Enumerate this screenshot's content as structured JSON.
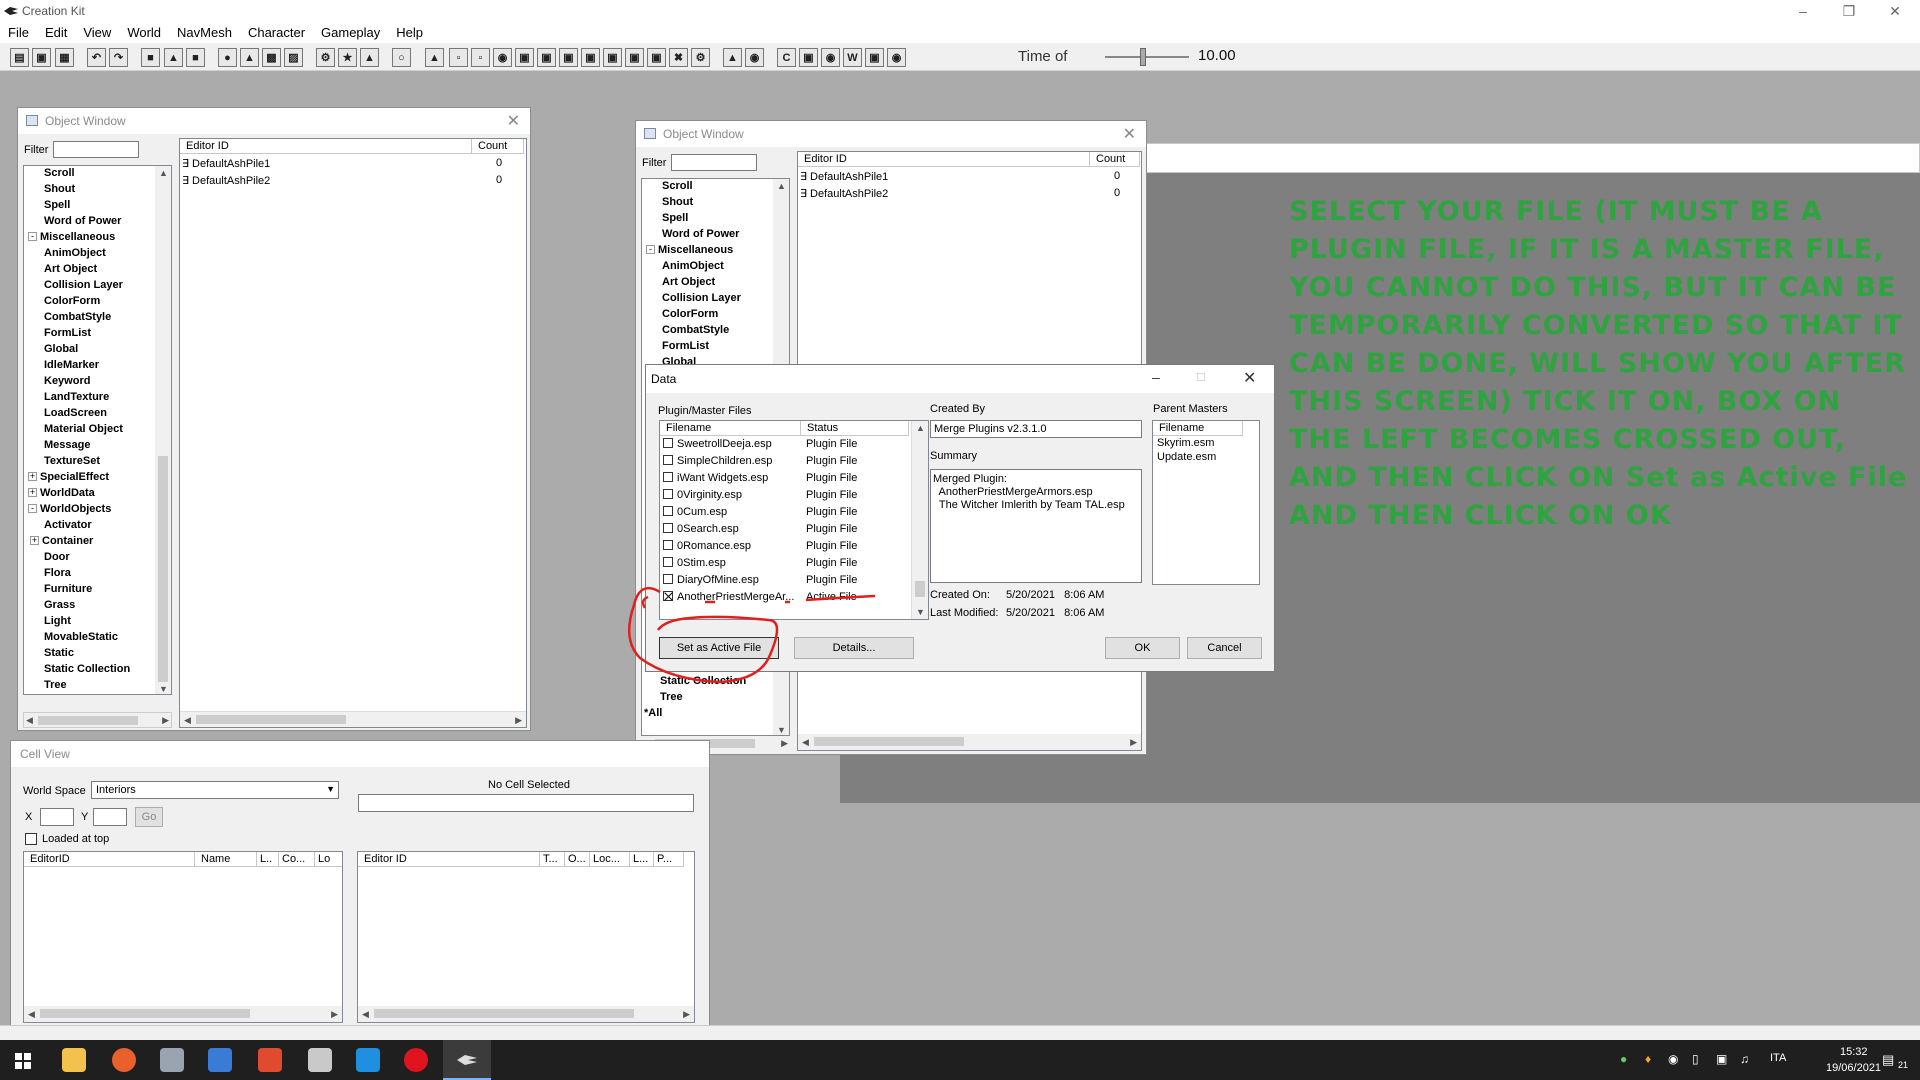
{
  "app": {
    "title": "Creation Kit"
  },
  "menu": [
    "File",
    "Edit",
    "View",
    "World",
    "NavMesh",
    "Character",
    "Gameplay",
    "Help"
  ],
  "toolbar": {
    "time_label": "Time of",
    "time_value": "10.00",
    "time_fraction": 0.45
  },
  "object_window": {
    "title": "Object Window",
    "filter_label": "Filter",
    "col_editor_id": "Editor ID",
    "col_count": "Count",
    "rows": [
      {
        "id": "DefaultAshPile1",
        "count": "0"
      },
      {
        "id": "DefaultAshPile2",
        "count": "0"
      }
    ],
    "tree": [
      {
        "label": "Scroll",
        "level": 1
      },
      {
        "label": "Shout",
        "level": 1
      },
      {
        "label": "Spell",
        "level": 1
      },
      {
        "label": "Word of Power",
        "level": 1
      },
      {
        "label": "Miscellaneous",
        "level": 0,
        "exp": "-"
      },
      {
        "label": "AnimObject",
        "level": 1
      },
      {
        "label": "Art Object",
        "level": 1
      },
      {
        "label": "Collision Layer",
        "level": 1
      },
      {
        "label": "ColorForm",
        "level": 1
      },
      {
        "label": "CombatStyle",
        "level": 1
      },
      {
        "label": "FormList",
        "level": 1
      },
      {
        "label": "Global",
        "level": 1
      },
      {
        "label": "IdleMarker",
        "level": 1
      },
      {
        "label": "Keyword",
        "level": 1
      },
      {
        "label": "LandTexture",
        "level": 1
      },
      {
        "label": "LoadScreen",
        "level": 1
      },
      {
        "label": "Material Object",
        "level": 1
      },
      {
        "label": "Message",
        "level": 1
      },
      {
        "label": "TextureSet",
        "level": 1
      },
      {
        "label": "SpecialEffect",
        "level": 0,
        "exp": "+"
      },
      {
        "label": "WorldData",
        "level": 0,
        "exp": "+"
      },
      {
        "label": "WorldObjects",
        "level": 0,
        "exp": "-"
      },
      {
        "label": "Activator",
        "level": 1
      },
      {
        "label": "Container",
        "level": 1,
        "exp": "+"
      },
      {
        "label": "Door",
        "level": 1
      },
      {
        "label": "Flora",
        "level": 1
      },
      {
        "label": "Furniture",
        "level": 1
      },
      {
        "label": "Grass",
        "level": 1
      },
      {
        "label": "Light",
        "level": 1
      },
      {
        "label": "MovableStatic",
        "level": 1
      },
      {
        "label": "Static",
        "level": 1
      },
      {
        "label": "Static Collection",
        "level": 1
      },
      {
        "label": "Tree",
        "level": 1
      },
      {
        "label": "*All",
        "level": 0
      }
    ],
    "tree2_bottom": [
      "Static Collection",
      "Tree",
      "*All"
    ]
  },
  "cell_view": {
    "title": "Cell View",
    "world_space_label": "World Space",
    "world_space_value": "Interiors",
    "x_label": "X",
    "y_label": "Y",
    "go_label": "Go",
    "no_cell": "No Cell Selected",
    "loaded_at_top": "Loaded at top",
    "left_cols": [
      "EditorID",
      "Name",
      "L..",
      "Co...",
      "Lo"
    ],
    "right_cols": [
      "Editor ID",
      "T...",
      "O...",
      "Loc...",
      "L...",
      "P..."
    ]
  },
  "data_dialog": {
    "title": "Data",
    "files_label": "Plugin/Master Files",
    "col_filename": "Filename",
    "col_status": "Status",
    "files": [
      {
        "name": "SweetrollDeeja.esp",
        "status": "Plugin File",
        "checked": false
      },
      {
        "name": "SimpleChildren.esp",
        "status": "Plugin File",
        "checked": false
      },
      {
        "name": "iWant Widgets.esp",
        "status": "Plugin File",
        "checked": false
      },
      {
        "name": "0Virginity.esp",
        "status": "Plugin File",
        "checked": false
      },
      {
        "name": "0Cum.esp",
        "status": "Plugin File",
        "checked": false
      },
      {
        "name": "0Search.esp",
        "status": "Plugin File",
        "checked": false
      },
      {
        "name": "0Romance.esp",
        "status": "Plugin File",
        "checked": false
      },
      {
        "name": "0Stim.esp",
        "status": "Plugin File",
        "checked": false
      },
      {
        "name": "DiaryOfMine.esp",
        "status": "Plugin File",
        "checked": false
      },
      {
        "name": "AnotherPriestMergeAr...",
        "status": "Active File",
        "checked": true
      }
    ],
    "created_by_label": "Created By",
    "created_by_value": "Merge Plugins v2.3.1.0",
    "summary_label": "Summary",
    "summary_text": "Merged Plugin:\n  AnotherPriestMergeArmors.esp\n  The Witcher Imlerith by Team TAL.esp",
    "parent_masters_label": "Parent Masters",
    "parent_col": "Filename",
    "parent_masters": [
      "Skyrim.esm",
      "Update.esm"
    ],
    "created_on_label": "Created On:",
    "created_on_value": "5/20/2021   8:06 AM",
    "last_modified_label": "Last Modified:",
    "last_modified_value": "5/20/2021   8:06 AM",
    "set_active_label": "Set as Active File",
    "details_label": "Details...",
    "ok_label": "OK",
    "cancel_label": "Cancel"
  },
  "overlay_text": "SELECT YOUR FILE (IT MUST BE A PLUGIN FILE, IF IT IS A MASTER FILE, YOU CANNOT DO THIS, BUT IT CAN BE TEMPORARILY CONVERTED SO THAT IT CAN BE DONE, WILL SHOW YOU AFTER THIS SCREEN) TICK IT ON, BOX ON THE LEFT BECOMES CROSSED OUT, AND THEN CLICK ON  Set as Active File    AND THEN CLICK ON OK",
  "colors": {
    "overlay_text": "#2fa33f",
    "annotation": "#e0201c"
  },
  "taskbar": {
    "lang": "ITA",
    "time": "15:32",
    "date": "19/06/2021",
    "notif_count": "21"
  }
}
